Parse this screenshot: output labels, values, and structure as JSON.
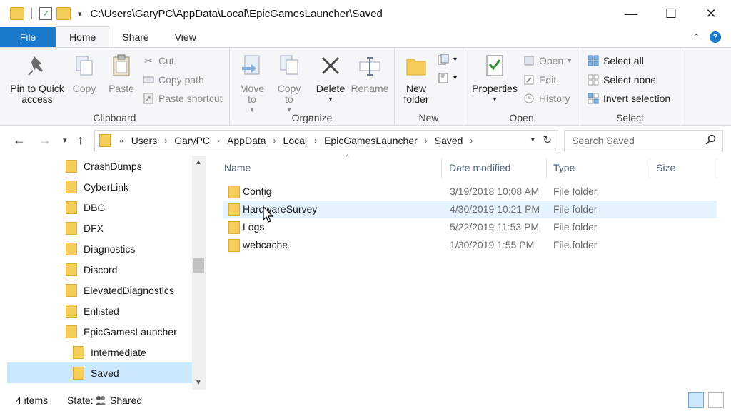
{
  "window": {
    "title_path": "C:\\Users\\GaryPC\\AppData\\Local\\EpicGamesLauncher\\Saved",
    "minimize": "—",
    "maximize": "☐",
    "close": "✕"
  },
  "ribbon_tabs": [
    "File",
    "Home",
    "Share",
    "View"
  ],
  "ribbon": {
    "clipboard": {
      "label": "Clipboard",
      "pin": "Pin to Quick access",
      "copy": "Copy",
      "paste": "Paste",
      "cut": "Cut",
      "copy_path": "Copy path",
      "paste_shortcut": "Paste shortcut"
    },
    "organize": {
      "label": "Organize",
      "move_to": "Move to",
      "copy_to": "Copy to",
      "delete": "Delete",
      "rename": "Rename"
    },
    "new": {
      "label": "New",
      "new_folder": "New folder"
    },
    "open": {
      "label": "Open",
      "properties": "Properties",
      "open": "Open",
      "edit": "Edit",
      "history": "History"
    },
    "select": {
      "label": "Select",
      "select_all": "Select all",
      "select_none": "Select none",
      "invert_selection": "Invert selection"
    }
  },
  "address": {
    "prefix": "«",
    "crumbs": [
      "Users",
      "GaryPC",
      "AppData",
      "Local",
      "EpicGamesLauncher",
      "Saved"
    ]
  },
  "search": {
    "placeholder": "Search Saved"
  },
  "nav_pane": {
    "items": [
      {
        "label": "CrashDumps",
        "indent": 0,
        "selected": false
      },
      {
        "label": "CyberLink",
        "indent": 0,
        "selected": false
      },
      {
        "label": "DBG",
        "indent": 0,
        "selected": false
      },
      {
        "label": "DFX",
        "indent": 0,
        "selected": false
      },
      {
        "label": "Diagnostics",
        "indent": 0,
        "selected": false
      },
      {
        "label": "Discord",
        "indent": 0,
        "selected": false
      },
      {
        "label": "ElevatedDiagnostics",
        "indent": 0,
        "selected": false
      },
      {
        "label": "Enlisted",
        "indent": 0,
        "selected": false
      },
      {
        "label": "EpicGamesLauncher",
        "indent": 0,
        "selected": false
      },
      {
        "label": "Intermediate",
        "indent": 1,
        "selected": false
      },
      {
        "label": "Saved",
        "indent": 1,
        "selected": true
      }
    ]
  },
  "columns": {
    "name": "Name",
    "date_modified": "Date modified",
    "type": "Type",
    "size": "Size"
  },
  "files": [
    {
      "name": "Config",
      "date": "3/19/2018 10:08 AM",
      "type": "File folder"
    },
    {
      "name": "HardwareSurvey",
      "date": "4/30/2019 10:21 PM",
      "type": "File folder"
    },
    {
      "name": "Logs",
      "date": "5/22/2019 11:53 PM",
      "type": "File folder"
    },
    {
      "name": "webcache",
      "date": "1/30/2019 1:55 PM",
      "type": "File folder"
    }
  ],
  "status": {
    "item_count": "4 items",
    "state_label": "State:",
    "state_value": "Shared"
  },
  "colors": {
    "accent": "#1979ca",
    "folder": "#f4cd5b",
    "selection": "#cce8ff",
    "hover": "#e5f3ff"
  }
}
